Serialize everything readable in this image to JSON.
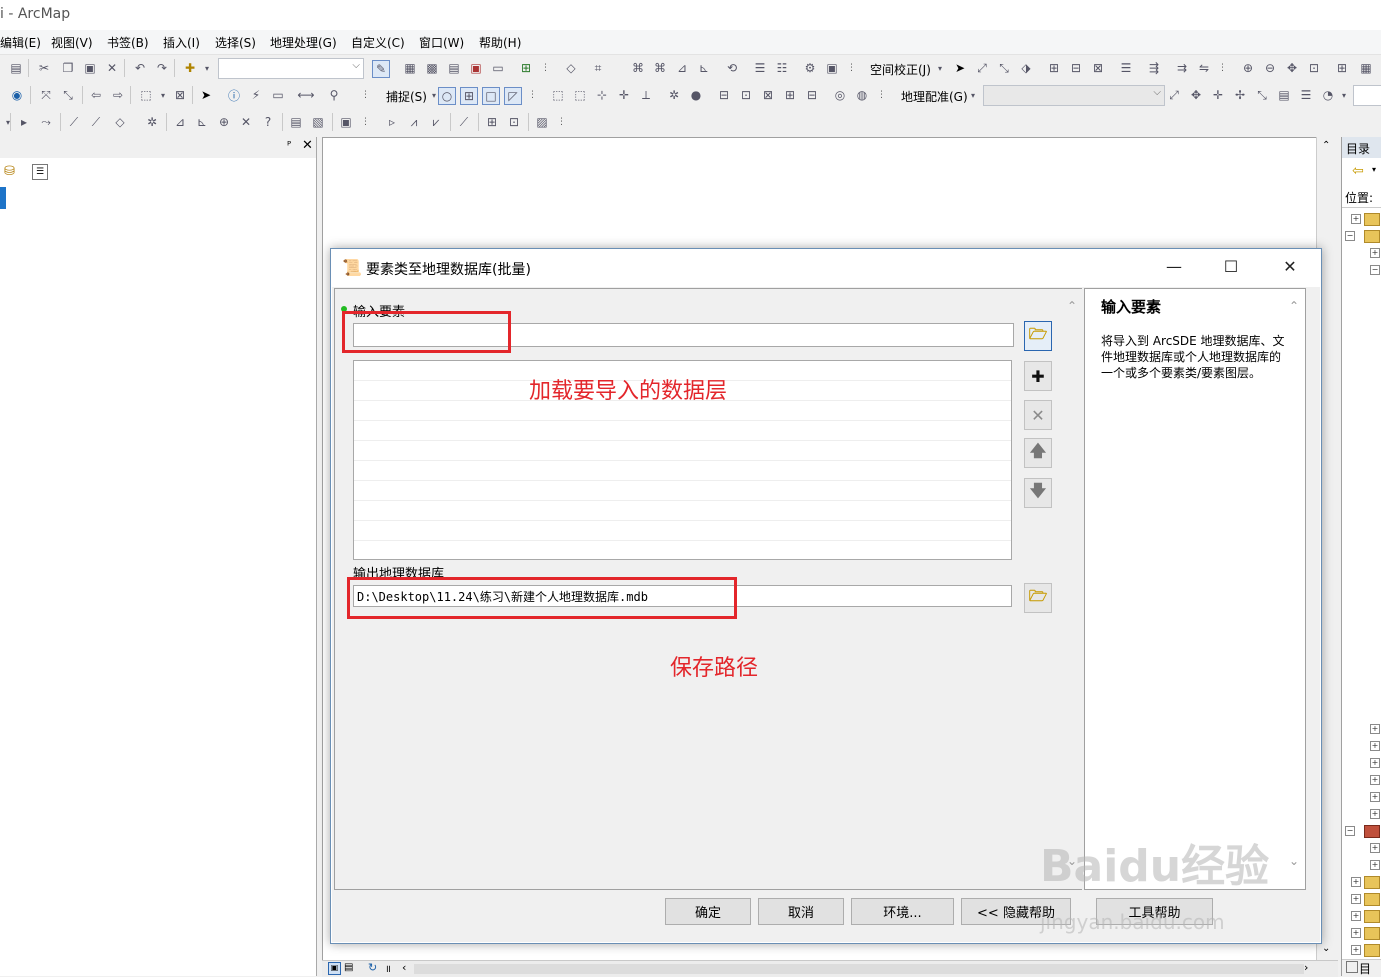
{
  "app": {
    "title": "i - ArcMap"
  },
  "menu": [
    "编辑(E)",
    "视图(V)",
    "书签(B)",
    "插入(I)",
    "选择(S)",
    "地理处理(G)",
    "自定义(C)",
    "窗口(W)",
    "帮助(H)"
  ],
  "toolbar": {
    "spatial_adjust": "空间校正(J)",
    "snapping": "捕捉(S)",
    "georeferencing": "地理配准(G)"
  },
  "catalog": {
    "title": "目录",
    "location_label": "位置:",
    "bottom_label": "目"
  },
  "dialog": {
    "title": "要素类至地理数据库(批量)",
    "input_features_label": "输入要素",
    "input_features_value": "",
    "output_gdb_label": "输出地理数据库",
    "output_gdb_value": "D:\\Desktop\\11.24\\练习\\新建个人地理数据库.mdb",
    "help_title": "输入要素",
    "help_body": "将导入到 ArcSDE 地理数据库、文件地理数据库或个人地理数据库的一个或多个要素类/要素图层。",
    "buttons": {
      "ok": "确定",
      "cancel": "取消",
      "env": "环境...",
      "hide_help": "<< 隐藏帮助",
      "tool_help": "工具帮助"
    }
  },
  "annotations": {
    "load_layers": "加载要导入的数据层",
    "save_path": "保存路径"
  },
  "watermark": {
    "main": "Baidu经验",
    "sub": "jingyan.baidu.com"
  },
  "colors": {
    "annotation_red": "#e3262b",
    "dialog_border": "#6a8fb5"
  }
}
